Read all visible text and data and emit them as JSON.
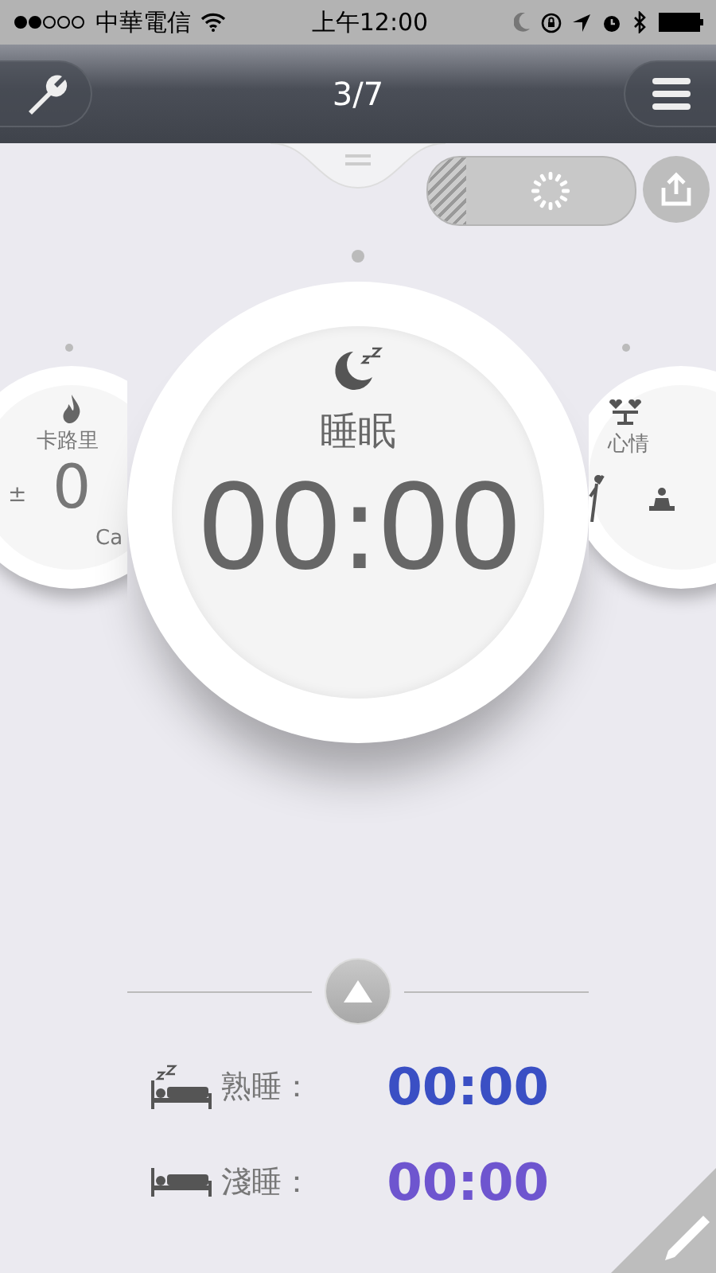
{
  "status_bar": {
    "carrier": "中華電信",
    "time": "上午12:00"
  },
  "nav_bar": {
    "title": "3/7"
  },
  "dials": [
    {
      "kind": "calories",
      "title": "卡路里",
      "value": "0",
      "unit": "Ca",
      "adjust": "±"
    },
    {
      "kind": "main",
      "title": "睡眠",
      "value": "00:00"
    },
    {
      "kind": "mood",
      "title": "心情"
    }
  ],
  "sleep_stats": [
    {
      "kind": "deep",
      "label": "熟睡：",
      "value": "00:00",
      "color": "#3a4fc4"
    },
    {
      "kind": "light",
      "label": "淺睡：",
      "value": "00:00",
      "color": "#6e55cf"
    }
  ]
}
